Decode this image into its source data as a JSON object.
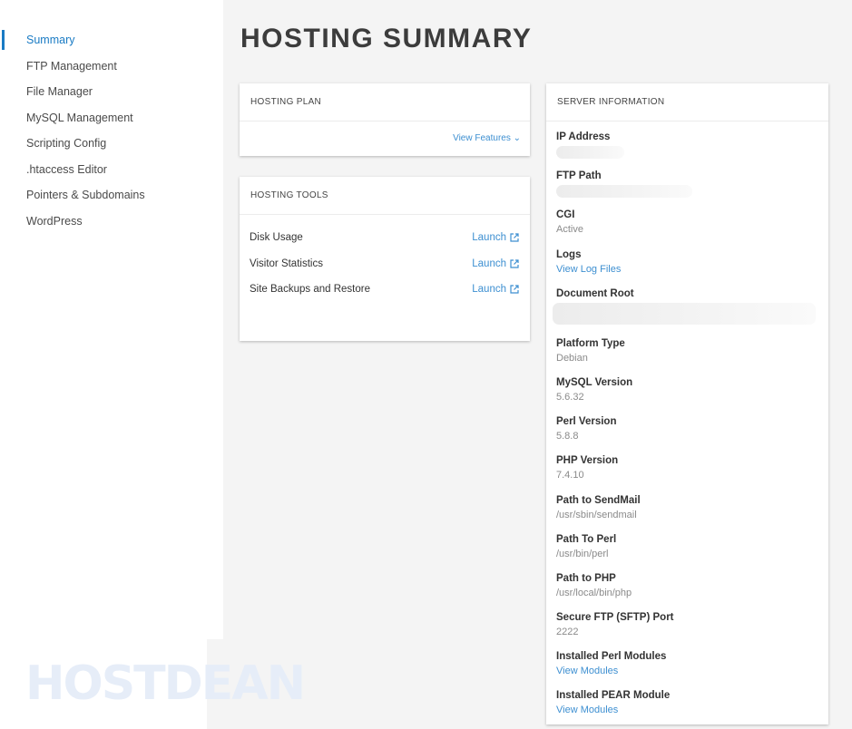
{
  "sidebar": {
    "items": [
      {
        "label": "Summary",
        "active": true
      },
      {
        "label": "FTP Management"
      },
      {
        "label": "File Manager"
      },
      {
        "label": "MySQL Management"
      },
      {
        "label": "Scripting Config"
      },
      {
        "label": ".htaccess Editor"
      },
      {
        "label": "Pointers & Subdomains"
      },
      {
        "label": "WordPress"
      }
    ],
    "watermark": "HOSTDEAN"
  },
  "page": {
    "title": "HOSTING SUMMARY"
  },
  "plan": {
    "header": "HOSTING PLAN",
    "view_features": "View Features ⌄"
  },
  "tools": {
    "header": "HOSTING TOOLS",
    "rows": [
      {
        "label": "Disk Usage",
        "action": "Launch"
      },
      {
        "label": "Visitor Statistics",
        "action": "Launch"
      },
      {
        "label": "Site Backups and Restore",
        "action": "Launch"
      }
    ]
  },
  "server": {
    "header": "SERVER INFORMATION",
    "ip_label": "IP Address",
    "ftp_path_label": "FTP Path",
    "cgi_label": "CGI",
    "cgi_value": "Active",
    "logs_label": "Logs",
    "logs_value": "View Log Files",
    "docroot_label": "Document Root",
    "platform_label": "Platform Type",
    "platform_value": "Debian",
    "mysql_label": "MySQL Version",
    "mysql_value": "5.6.32",
    "perl_label": "Perl Version",
    "perl_value": "5.8.8",
    "php_label": "PHP Version",
    "php_value": "7.4.10",
    "sendmail_label": "Path to SendMail",
    "sendmail_value": "/usr/sbin/sendmail",
    "perlpath_label": "Path To Perl",
    "perlpath_value": "/usr/bin/perl",
    "phppath_label": "Path to PHP",
    "phppath_value": "/usr/local/bin/php",
    "sftp_label": "Secure FTP (SFTP) Port",
    "sftp_value": "2222",
    "perlmods_label": "Installed Perl Modules",
    "perlmods_value": "View Modules",
    "pear_label": "Installed PEAR Module",
    "pear_value": "View Modules"
  },
  "colors": {
    "accent": "#1a7bc4",
    "link": "#3d8fd1"
  }
}
